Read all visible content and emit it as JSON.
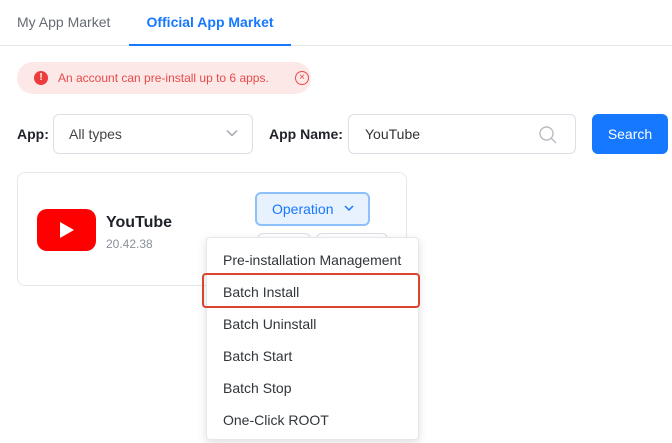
{
  "tabs": [
    {
      "label": "My App Market"
    },
    {
      "label": "Official App Market"
    }
  ],
  "alert": {
    "message": "An account can pre-install up to 6 apps.",
    "icon": "error-circle-icon",
    "close_icon": "close-circle-icon"
  },
  "filters": {
    "app_label": "App:",
    "app_type_value": "All types",
    "app_name_label": "App Name:",
    "app_name_value": "YouTube",
    "search_button": "Search"
  },
  "app_card": {
    "name": "YouTube",
    "version": "20.42.38",
    "logo": "youtube-logo",
    "operation_label": "Operation"
  },
  "menu": {
    "items": [
      {
        "label": "Pre-installation Management"
      },
      {
        "label": "Batch Install"
      },
      {
        "label": "Batch Uninstall"
      },
      {
        "label": "Batch Start"
      },
      {
        "label": "Batch Stop"
      },
      {
        "label": "One-Click ROOT"
      }
    ],
    "highlighted": "Batch Install"
  },
  "colors": {
    "accent": "#1677ff",
    "alert_bg": "#fde8e8",
    "alert_text": "#e84a4a",
    "highlight_border": "#d9442c",
    "youtube_red": "#ff0000"
  }
}
